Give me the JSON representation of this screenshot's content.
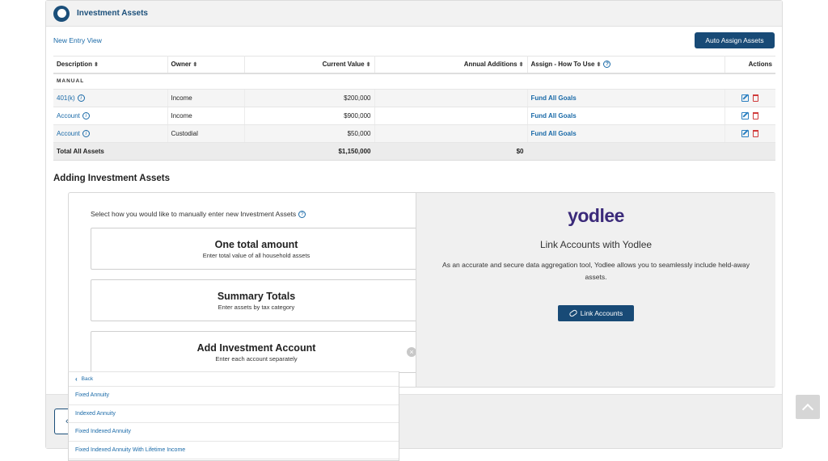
{
  "header": {
    "title": "Investment Assets"
  },
  "toolbar": {
    "new_entry_view": "New Entry View",
    "auto_assign": "Auto Assign Assets"
  },
  "table": {
    "columns": [
      "Description",
      "Owner",
      "Current Value",
      "Annual Additions",
      "Assign - How To Use",
      "Actions"
    ],
    "group_label": "MANUAL",
    "rows": [
      {
        "description": "401(k)",
        "owner": "Income",
        "current_value": "$200,000",
        "annual_additions": "",
        "assign": "Fund All Goals"
      },
      {
        "description": "Account",
        "owner": "Income",
        "current_value": "$900,000",
        "annual_additions": "",
        "assign": "Fund All Goals"
      },
      {
        "description": "Account",
        "owner": "Custodial",
        "current_value": "$50,000",
        "annual_additions": "",
        "assign": "Fund All Goals"
      }
    ],
    "total": {
      "label": "Total All Assets",
      "current_value": "$1,150,000",
      "annual_additions": "$0"
    }
  },
  "adding": {
    "title": "Adding Investment Assets",
    "prompt": "Select how you would like to manually enter new Investment Assets",
    "options": [
      {
        "title": "One total amount",
        "subtitle": "Enter total value of all household assets"
      },
      {
        "title": "Summary Totals",
        "subtitle": "Enter assets by tax category"
      },
      {
        "title": "Add Investment Account",
        "subtitle": "Enter each account separately"
      }
    ],
    "dropdown": {
      "back": "Back",
      "items": [
        "Fixed Annuity",
        "Indexed Annuity",
        "Fixed Indexed Annuity",
        "Fixed Indexed Annuity With Lifetime Income"
      ]
    }
  },
  "yodlee": {
    "logo": "yodlee",
    "title": "Link Accounts with Yodlee",
    "description": "As an accurate and secure data aggregation tool, Yodlee allows you to seamlessly include held-away assets.",
    "button": "Link Accounts"
  },
  "colors": {
    "primary": "#184a76",
    "link": "#1a6aa8",
    "danger": "#d03a3a",
    "yodlee": "#3b2a7a"
  }
}
